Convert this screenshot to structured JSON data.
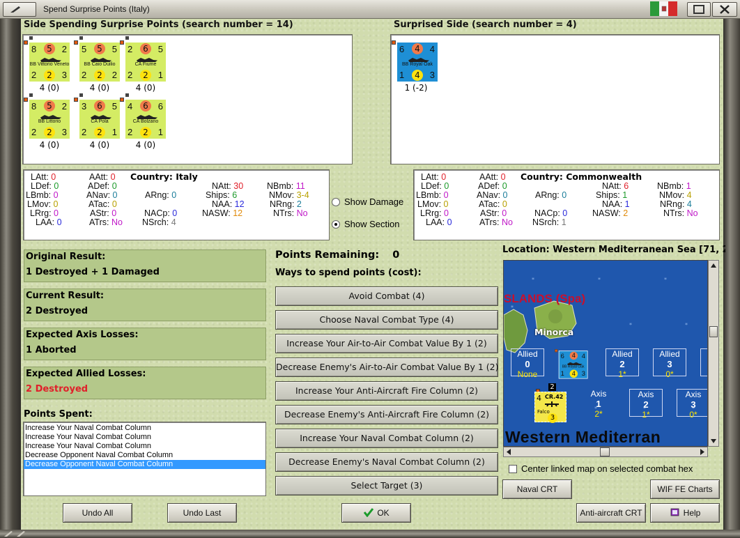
{
  "window": {
    "title": "Spend Surprise Points (Italy)"
  },
  "left_panel": {
    "heading": "Side Spending Surprise Points (search number = 14)",
    "counters": [
      {
        "tl": "8",
        "top": "5",
        "tr": "2",
        "name": "BB Vittorio Veneto",
        "bl": "2",
        "bot": "2",
        "br": "3",
        "caption": "4 (0)"
      },
      {
        "tl": "5",
        "top": "5",
        "tr": "5",
        "name": "BB Caio Duilio",
        "bl": "2",
        "bot": "2",
        "br": "2",
        "caption": "4 (0)"
      },
      {
        "tl": "2",
        "top": "6",
        "tr": "5",
        "name": "CA Fiume",
        "bl": "2",
        "bot": "2",
        "br": "1",
        "caption": "4 (0)"
      },
      {
        "tl": "8",
        "top": "5",
        "tr": "2",
        "name": "BB Littorio",
        "bl": "2",
        "bot": "2",
        "br": "3",
        "caption": "4 (0)"
      },
      {
        "tl": "3",
        "top": "6",
        "tr": "5",
        "name": "CA Pola",
        "bl": "2",
        "bot": "2",
        "br": "1",
        "caption": "4 (0)"
      },
      {
        "tl": "4",
        "top": "6",
        "tr": "6",
        "name": "CA Bolzano",
        "bl": "2",
        "bot": "2",
        "br": "1",
        "caption": "4 (0)"
      }
    ]
  },
  "right_panel": {
    "heading": "Surprised Side (search number = 4)",
    "counter": {
      "tl": "6",
      "top": "4",
      "tr": "4",
      "name": "BB Royal Oak",
      "bl": "1",
      "bot": "4",
      "br": "3",
      "caption": "1 (-2)"
    }
  },
  "stats_italy": {
    "country_label": "Country:",
    "country": "Italy",
    "LAtt": "0",
    "LDef": "0",
    "LBmb": "0",
    "LMov": "0",
    "LRrg": "0",
    "LAA": "0",
    "AAtt": "0",
    "ADef": "0",
    "ANav": "0",
    "ATac": "0",
    "AStr": "0",
    "ATrs": "No",
    "ARng": "0",
    "NACp": "0",
    "NSrch": "4",
    "NAtt": "30",
    "Ships": "6",
    "NAA": "12",
    "NASW": "12",
    "NBmb": "11",
    "NMov": "3-4",
    "NRng": "2",
    "NTrs": "No"
  },
  "stats_commonwealth": {
    "country_label": "Country:",
    "country": "Commonwealth",
    "LAtt": "0",
    "LDef": "0",
    "LBmb": "0",
    "LMov": "0",
    "LRrg": "0",
    "LAA": "0",
    "AAtt": "0",
    "ADef": "0",
    "ANav": "0",
    "ATac": "0",
    "AStr": "0",
    "ATrs": "No",
    "ARng": "0",
    "NACp": "0",
    "NSrch": "1",
    "NAtt": "6",
    "Ships": "1",
    "NAA": "1",
    "NASW": "2",
    "NBmb": "1",
    "NMov": "4",
    "NRng": "4",
    "NTrs": "No"
  },
  "options": {
    "show_damage": "Show Damage",
    "show_section": "Show Section",
    "selected": "Show Section"
  },
  "results": {
    "original_label": "Original Result:",
    "original_value": "1 Destroyed + 1 Damaged",
    "current_label": "Current Result:",
    "current_value": "2 Destroyed",
    "axis_label": "Expected Axis Losses:",
    "axis_value": "1 Aborted",
    "allied_label": "Expected Allied Losses:",
    "allied_value": "2 Destroyed"
  },
  "points_spent": {
    "label": "Points Spent:",
    "items": [
      "Increase Your Naval Combat Column",
      "Increase Your Naval Combat Column",
      "Increase Your Naval Combat Column",
      "Decrease Opponent Naval Combat Column",
      "Decrease Opponent Naval Combat Column"
    ],
    "selected_index": 4
  },
  "spend": {
    "remaining_label": "Points Remaining:",
    "remaining_value": "0",
    "ways_label": "Ways to spend points (cost):",
    "options": [
      "Avoid Combat (4)",
      "Choose Naval Combat Type (4)",
      "Increase Your Air-to-Air Combat Value By 1 (2)",
      "Decrease Enemy's Air-to-Air Combat Value By 1 (2)",
      "Increase Your Anti-Aircraft Fire Column (2)",
      "Decrease Enemy's Anti-Aircraft Fire Column (2)",
      "Increase Your Naval Combat Column (2)",
      "Decrease Enemy's Naval Combat Column (2)",
      "Select Target (3)"
    ]
  },
  "map": {
    "location": "Location: Western Mediterranean Sea [71, 2",
    "islands_label": "SLANDS (Spa)",
    "island_name": "Minorca",
    "sea_label": "Western Mediterran",
    "allied_boxes": [
      {
        "side": "Allied",
        "num": "0",
        "val": "None"
      },
      {
        "side": "Allied",
        "num": "2",
        "val": "1*"
      },
      {
        "side": "Allied",
        "num": "3",
        "val": "0*"
      }
    ],
    "axis_boxes": [
      {
        "side": "Axis",
        "num": "1",
        "val": "2*"
      },
      {
        "side": "Axis",
        "num": "2",
        "val": "1*"
      },
      {
        "side": "Axis",
        "num": "3",
        "val": "0*"
      }
    ],
    "royal_oak": {
      "tl": "6",
      "top": "4",
      "tr": "4",
      "name": "BB Royal Oak",
      "bl": "1",
      "bot": "4",
      "br": "3"
    },
    "air_unit": {
      "tl": "4",
      "name": "CR.42",
      "sub": "Falco",
      "bot": "3",
      "stack": "2"
    },
    "center_checkbox": "Center linked map on selected combat hex"
  },
  "buttons": {
    "undo_all": "Undo All",
    "undo_last": "Undo Last",
    "ok": "OK",
    "naval_crt": "Naval CRT",
    "wif_charts": "WIF FE Charts",
    "aa_crt": "Anti-aircraft CRT",
    "help": "Help"
  },
  "colors": {
    "background": "#d1dcae",
    "result_box": "#b4c88a",
    "italian_counter": "#d4ec64",
    "commonwealth_counter": "#1e8fd5",
    "sea": "#1f57ad",
    "destroyed_red": "#e0202a"
  }
}
